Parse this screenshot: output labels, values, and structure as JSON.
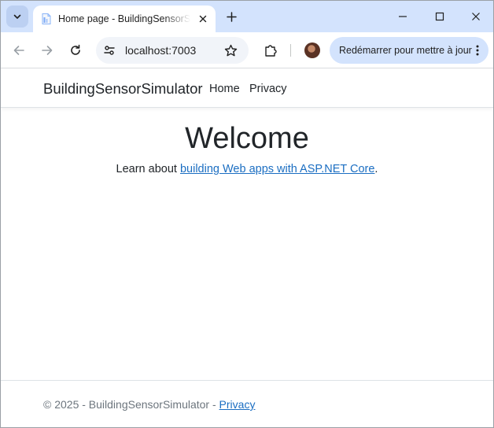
{
  "browser": {
    "tab": {
      "title": "Home page - BuildingSensorSimulator"
    },
    "address": {
      "url": "localhost:7003"
    },
    "update_button": {
      "label": "Redémarrer pour mettre à jour"
    }
  },
  "site": {
    "brand": "BuildingSensorSimulator",
    "nav": [
      "Home",
      "Privacy"
    ],
    "heading": "Welcome",
    "learn_prefix": "Learn about ",
    "learn_link": "building Web apps with ASP.NET Core",
    "learn_suffix": ".",
    "footer_text": "© 2025 - BuildingSensorSimulator - ",
    "footer_link": "Privacy"
  },
  "colors": {
    "tabstrip": "#d3e3fd",
    "link": "#1b6ec2",
    "text": "#212529"
  },
  "icons": {
    "tab_search": "chevron-down-icon",
    "favicon": "document-icon",
    "close": "close-icon",
    "new_tab": "plus-icon",
    "back": "arrow-left-icon",
    "forward": "arrow-right-icon",
    "reload": "reload-icon",
    "site_info": "tune-icon",
    "bookmark": "star-icon",
    "extensions": "puzzle-icon",
    "menu": "kebab-menu-icon"
  }
}
